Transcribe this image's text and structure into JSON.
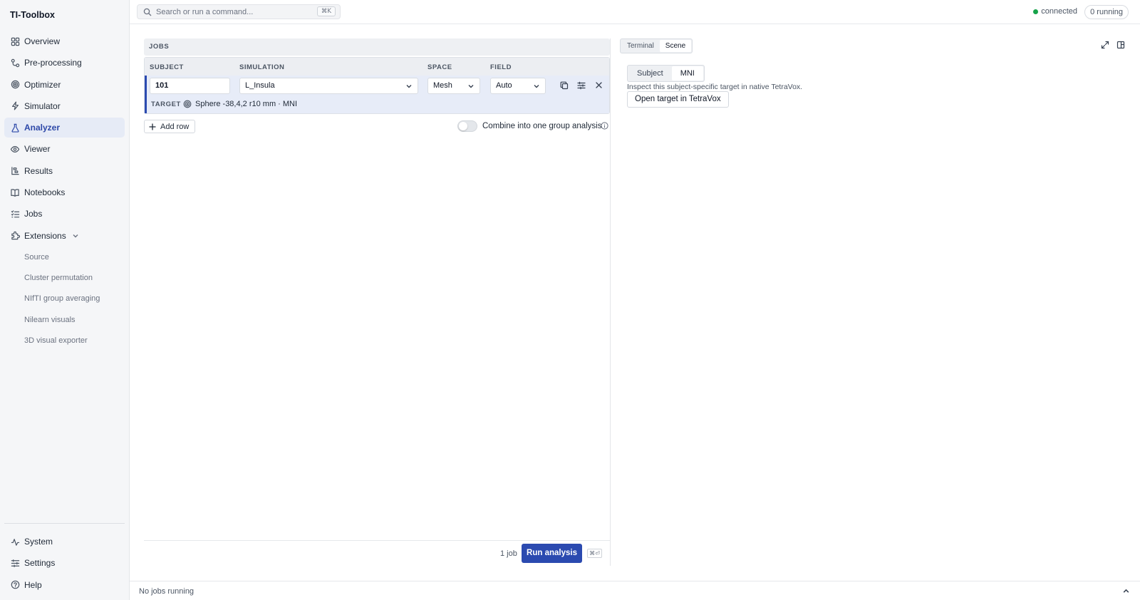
{
  "app": {
    "title": "TI-Toolbox"
  },
  "sidebar": {
    "items": [
      {
        "label": "Overview",
        "icon": "grid-icon"
      },
      {
        "label": "Pre-processing",
        "icon": "nodes-icon"
      },
      {
        "label": "Optimizer",
        "icon": "target-icon"
      },
      {
        "label": "Simulator",
        "icon": "bolt-icon"
      },
      {
        "label": "Analyzer",
        "icon": "flask-icon",
        "active": true
      },
      {
        "label": "Viewer",
        "icon": "eye-icon"
      },
      {
        "label": "Results",
        "icon": "results-icon"
      },
      {
        "label": "Notebooks",
        "icon": "book-icon"
      },
      {
        "label": "Jobs",
        "icon": "list-icon"
      },
      {
        "label": "Extensions",
        "icon": "puzzle-icon",
        "expanded": true
      }
    ],
    "extensions": [
      "Source",
      "Cluster permutation",
      "NIfTI group averaging",
      "Nilearn visuals",
      "3D visual exporter"
    ],
    "bottom_items": [
      {
        "label": "System",
        "icon": "activity-icon"
      },
      {
        "label": "Settings",
        "icon": "sliders-icon"
      },
      {
        "label": "Help",
        "icon": "help-icon"
      }
    ]
  },
  "topbar": {
    "search_placeholder": "Search or run a command...",
    "search_shortcut": "⌘K",
    "status": "connected",
    "running": "0 running"
  },
  "jobs": {
    "header": "JOBS",
    "columns": {
      "subject": "SUBJECT",
      "simulation": "SIMULATION",
      "space": "SPACE",
      "field": "FIELD"
    },
    "row": {
      "subject": "101",
      "simulation": "L_Insula",
      "space": "Mesh",
      "field": "Auto"
    },
    "target_label": "TARGET",
    "target_value": "Sphere -38,4,2 r10 mm · MNI",
    "add_row": "Add row",
    "combine_label": "Combine into one group analysis",
    "job_count": "1 job",
    "run_button": "Run analysis",
    "run_shortcut": "⌘⏎"
  },
  "right_panel": {
    "tabs": [
      "Terminal",
      "Scene"
    ],
    "active_tab": "Scene",
    "space_options": [
      "Subject",
      "MNI"
    ],
    "active_space": "MNI",
    "hint": "Inspect this subject-specific target in native TetraVox.",
    "open_button": "Open target in TetraVox"
  },
  "bottombar": {
    "status": "No jobs running"
  },
  "colors": {
    "accent": "#2b4ab0",
    "active_bg": "#e6ebf6",
    "connected": "#16a34a"
  }
}
